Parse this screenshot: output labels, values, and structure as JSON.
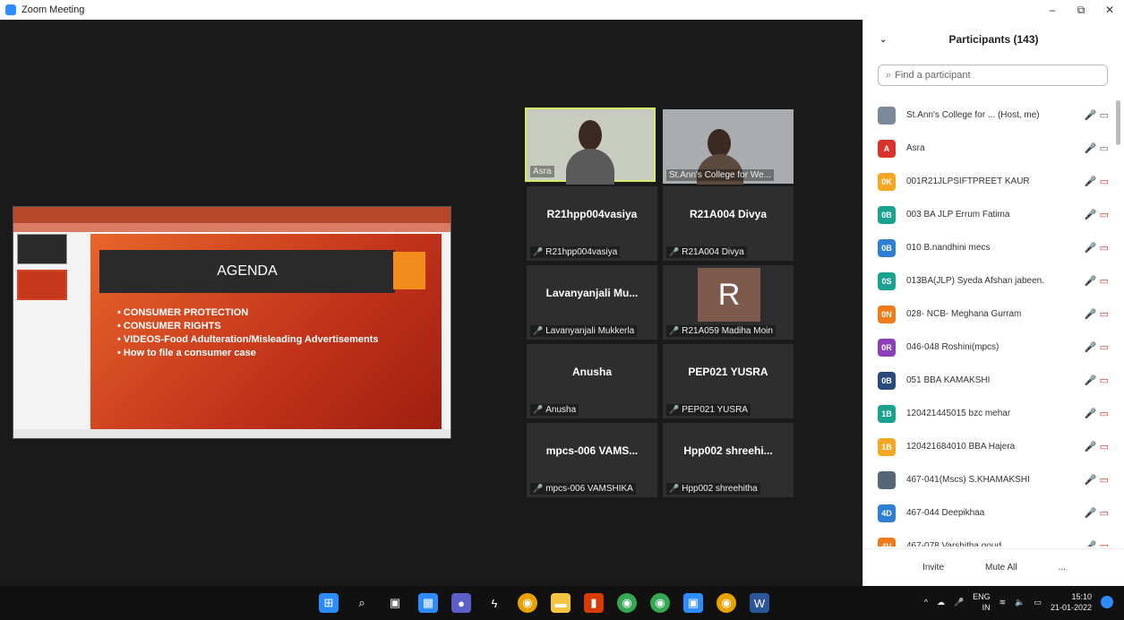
{
  "window": {
    "title": "Zoom Meeting",
    "controls": [
      "–",
      "⧉",
      "✕"
    ]
  },
  "slide": {
    "title": "AGENDA",
    "bullets": [
      "• CONSUMER PROTECTION",
      "• CONSUMER RIGHTS",
      "• VIDEOS-Food Adulteration/Misleading Advertisements",
      "• How to file a consumer case"
    ]
  },
  "tiles": [
    {
      "label": "Asra",
      "big": ""
    },
    {
      "label": "St.Ann's College for We...",
      "big": ""
    },
    {
      "label": "R21hpp004vasiya",
      "big": "R21hpp004vasiya"
    },
    {
      "label": "R21A004 Divya",
      "big": "R21A004 Divya"
    },
    {
      "label": "Lavanyanjali Mukkerla",
      "big": "Lavanyanjali Mu..."
    },
    {
      "label": "R21A059 Madiha Moin",
      "big": "R"
    },
    {
      "label": "Anusha",
      "big": "Anusha"
    },
    {
      "label": "PEP021 YUSRA",
      "big": "PEP021 YUSRA"
    },
    {
      "label": "mpcs-006 VAMSHIKA",
      "big": "mpcs-006 VAMS..."
    },
    {
      "label": "Hpp002 shreehitha",
      "big": "Hpp002 shreehi..."
    }
  ],
  "participants": {
    "header": "Participants (143)",
    "search_placeholder": "Find a participant",
    "rows": [
      {
        "initials": "",
        "color": "#7a8a9a",
        "name": "St.Ann's College for ... (Host, me)",
        "icons": "🎤 ▭"
      },
      {
        "initials": "A",
        "color": "#d9342b",
        "name": "Asra",
        "icons": "🎤 ▭"
      },
      {
        "initials": "0K",
        "color": "#f5a623",
        "name": "001R21JLPSIFTPREET KAUR",
        "icons": "🎤 ▭"
      },
      {
        "initials": "0B",
        "color": "#1aa190",
        "name": "003 BA JLP Errum Fatima",
        "icons": "🎤 ▭"
      },
      {
        "initials": "0B",
        "color": "#2d7fd3",
        "name": "010 B.nandhini mecs",
        "icons": "🎤 ▭"
      },
      {
        "initials": "0S",
        "color": "#1aa190",
        "name": "013BA(JLP) Syeda Afshan jabeen.",
        "icons": "🎤 ▭"
      },
      {
        "initials": "0N",
        "color": "#f07b1d",
        "name": "028- NCB- Meghana Gurram",
        "icons": "🎤 ▭"
      },
      {
        "initials": "0R",
        "color": "#8b3fb5",
        "name": "046-048 Roshini(mpcs)",
        "icons": "🎤 ▭"
      },
      {
        "initials": "0B",
        "color": "#2a4a7a",
        "name": "051 BBA KAMAKSHI",
        "icons": "🎤 ▭"
      },
      {
        "initials": "1B",
        "color": "#1aa190",
        "name": "120421445015 bzc mehar",
        "icons": "🎤 ▭"
      },
      {
        "initials": "1B",
        "color": "#f5a623",
        "name": "120421684010 BBA Hajera",
        "icons": "🎤 ▭"
      },
      {
        "initials": "",
        "color": "#556677",
        "name": "467-041(Mscs) S.KHAMAKSHI",
        "icons": "🎤 ▭"
      },
      {
        "initials": "4D",
        "color": "#2d7fd3",
        "name": "467-044 Deepikhaa",
        "icons": "🎤 ▭"
      },
      {
        "initials": "4V",
        "color": "#f07b1d",
        "name": "467-078 Varshitha goud",
        "icons": "🎤 ▭"
      }
    ],
    "invite_label": "Invite",
    "mute_all_label": "Mute All",
    "more_label": "..."
  },
  "taskbar": {
    "lang": "ENG",
    "region": "IN",
    "time": "15:10",
    "date": "21-01-2022"
  }
}
